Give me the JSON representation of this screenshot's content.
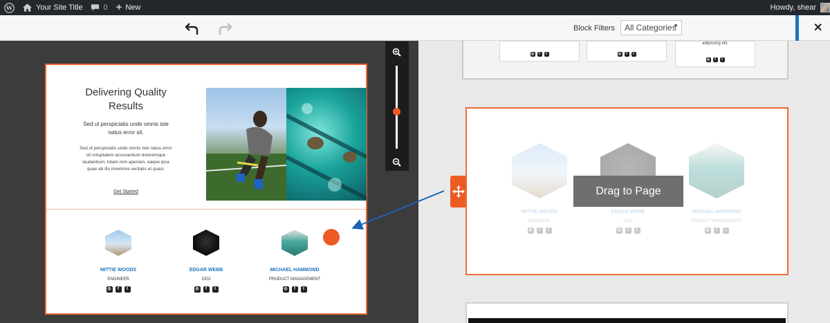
{
  "adminbar": {
    "site_title": "Your Site Title",
    "comments_count": "0",
    "new_label": "New",
    "greeting": "Howdy, shear"
  },
  "toolbar": {
    "block_filters_label": "Block Filters",
    "category_selected": "All Categories"
  },
  "preview": {
    "hero": {
      "title": "Delivering Quality Results",
      "subtitle": "Sed ut perspiciatis unde omnis iste natus error sit.",
      "body": "Sed ut perspiciatis unde omnis iste natus error sit voluptatem accusantium doloremque laudantium, totam rem aperiam, eaque ipsa quae ab illo inventore veritatis et quasi.",
      "link": "Get Started"
    },
    "team": [
      {
        "name": "MITTIE WOODS",
        "role": "ENGINEER"
      },
      {
        "name": "EDGAR WEBB",
        "role": "CEO"
      },
      {
        "name": "MICHAEL HAMMOND",
        "role": "PRODUCT MANAGEMENT"
      }
    ]
  },
  "canvas": {
    "top_snippet_text": "adipiscing elit.",
    "drop_label": "Drag to Page",
    "team": [
      {
        "name": "MITTIE WOODS",
        "role": "ENGINEER"
      },
      {
        "name": "EDGAR WEBB",
        "role": "CEO"
      },
      {
        "name": "MICHAEL HAMMOND",
        "role": "PRODUCT MANAGEMENT"
      }
    ]
  },
  "colors": {
    "accent": "#ee5a24",
    "link": "#1e73be",
    "admin_bar": "#23282d"
  }
}
